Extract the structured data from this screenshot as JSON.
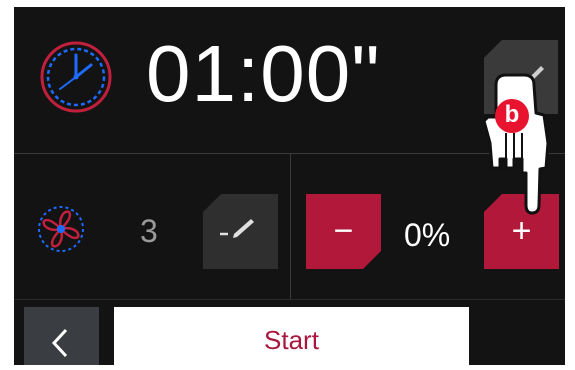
{
  "timer": {
    "value": "01:00\"",
    "icon": "clock-icon",
    "edit_icon": "pencil-icon"
  },
  "fan": {
    "icon": "fan-icon",
    "level": "3",
    "edit_label": "-",
    "edit_icon": "pencil-icon"
  },
  "humidity": {
    "minus_label": "−",
    "value": "0%",
    "plus_label": "+"
  },
  "footer": {
    "back_icon": "chevron-left-icon",
    "start_label": "Start"
  },
  "overlay": {
    "badge_label": "b",
    "pointer_icon": "hand-pointer-icon"
  },
  "colors": {
    "accent_red": "#b1183a",
    "clock_blue": "#1e6bff",
    "background": "#131313"
  }
}
